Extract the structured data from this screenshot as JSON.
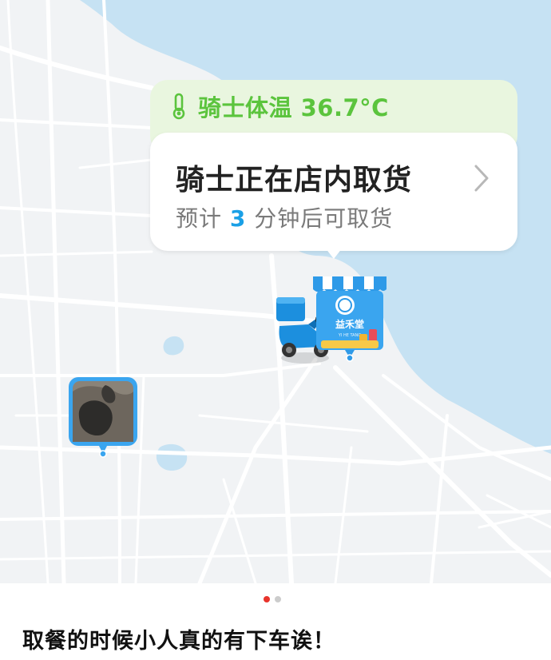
{
  "map": {
    "water_color": "#c6e2f3",
    "land_color": "#f1f3f5",
    "road_color": "#ffffff"
  },
  "rider_card": {
    "temperature_label": "骑士体温 36.7°C",
    "temperature_icon": "thermometer-icon",
    "status_title": "骑士正在店内取货",
    "chevron_icon": "chevron-right-icon",
    "eta_prefix": "预计 ",
    "eta_number": "3",
    "eta_suffix": " 分钟后可取货",
    "accent_color": "#1aa0e6",
    "temp_color": "#5bc43d"
  },
  "store_marker": {
    "store_name": "益禾堂",
    "store_name_en": "YI HE TANG",
    "icon": "storefront-icon"
  },
  "rider_marker": {
    "icon": "delivery-scooter-icon"
  },
  "user_marker": {
    "icon": "user-photo-pin"
  },
  "pager": {
    "total": 2,
    "active_index": 0
  },
  "caption": "取餐的时候小人真的有下车诶！"
}
